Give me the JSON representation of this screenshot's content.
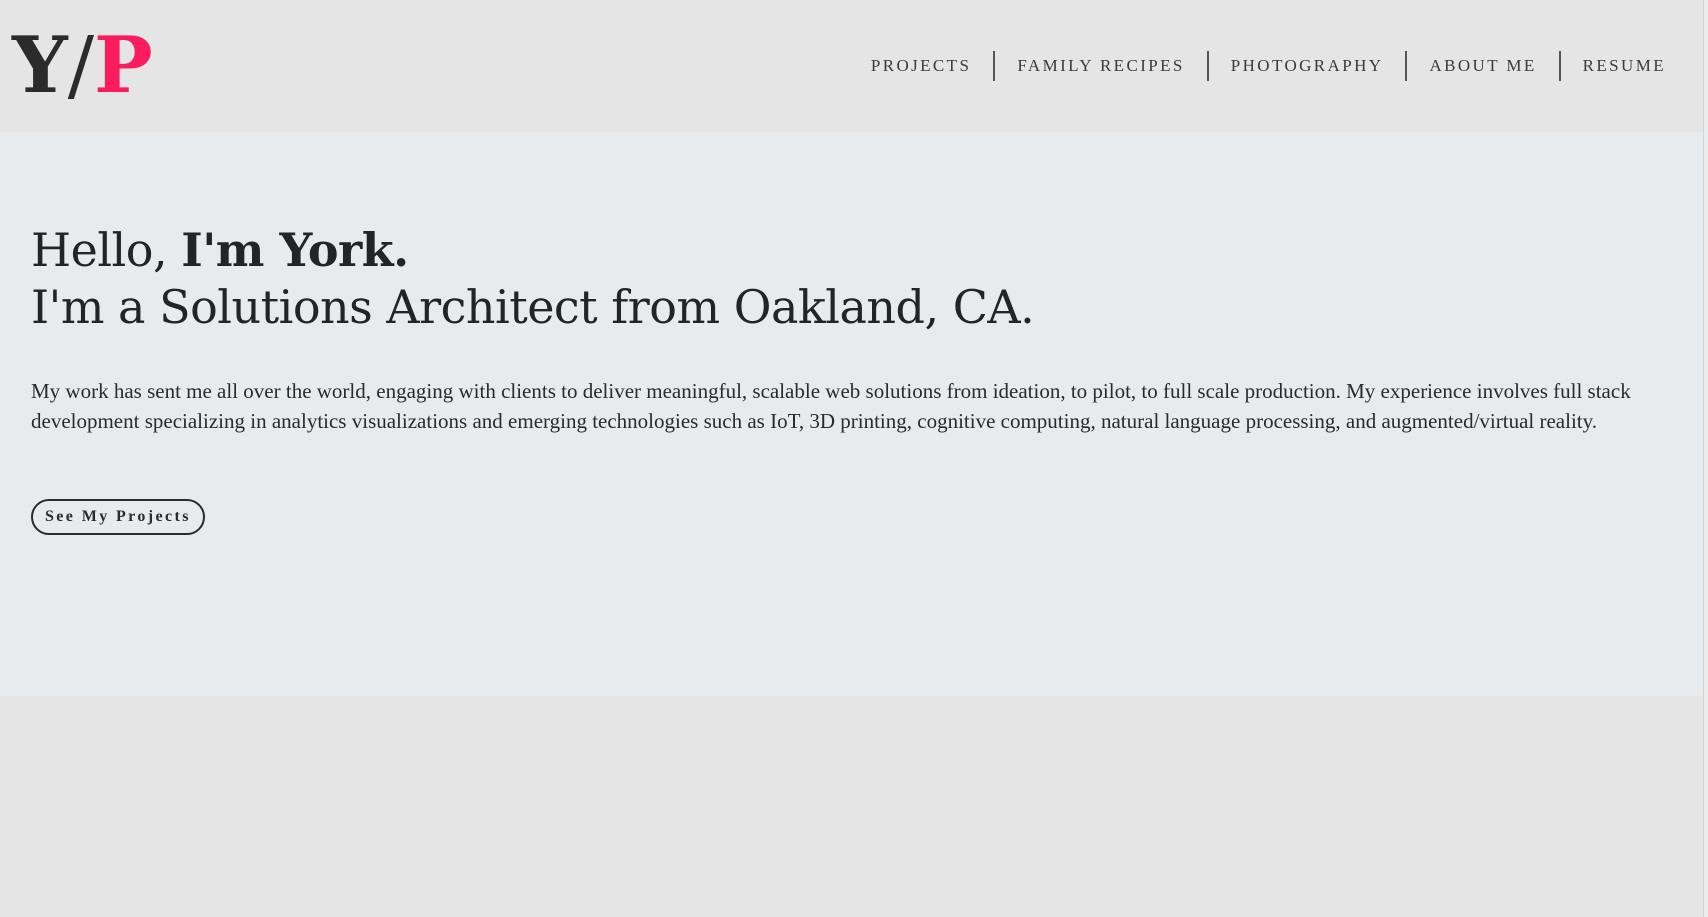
{
  "logo": {
    "y": "Y",
    "slash": "/",
    "p": "P",
    "accent_color": "#fb1c5f"
  },
  "nav": {
    "items": [
      {
        "label": "PROJECTS"
      },
      {
        "label": "FAMILY RECIPES"
      },
      {
        "label": "PHOTOGRAPHY"
      },
      {
        "label": "ABOUT ME"
      },
      {
        "label": "RESUME"
      }
    ]
  },
  "hero": {
    "greeting": "Hello, ",
    "name": "I'm York.",
    "tagline": "I'm a Solutions Architect from Oakland, CA.",
    "intro": "My work has sent me all over the world, engaging with clients to deliver meaningful, scalable web solutions from ideation, to pilot, to full scale production. My experience involves full stack development specializing in analytics visualizations and emerging technologies such as IoT, 3D printing, cognitive computing, natural language processing, and augmented/virtual reality.",
    "cta_label": "See My Projects"
  },
  "colors": {
    "header_bg": "#e5e5e5",
    "hero_bg": "#e8ebee",
    "text": "#222426"
  }
}
